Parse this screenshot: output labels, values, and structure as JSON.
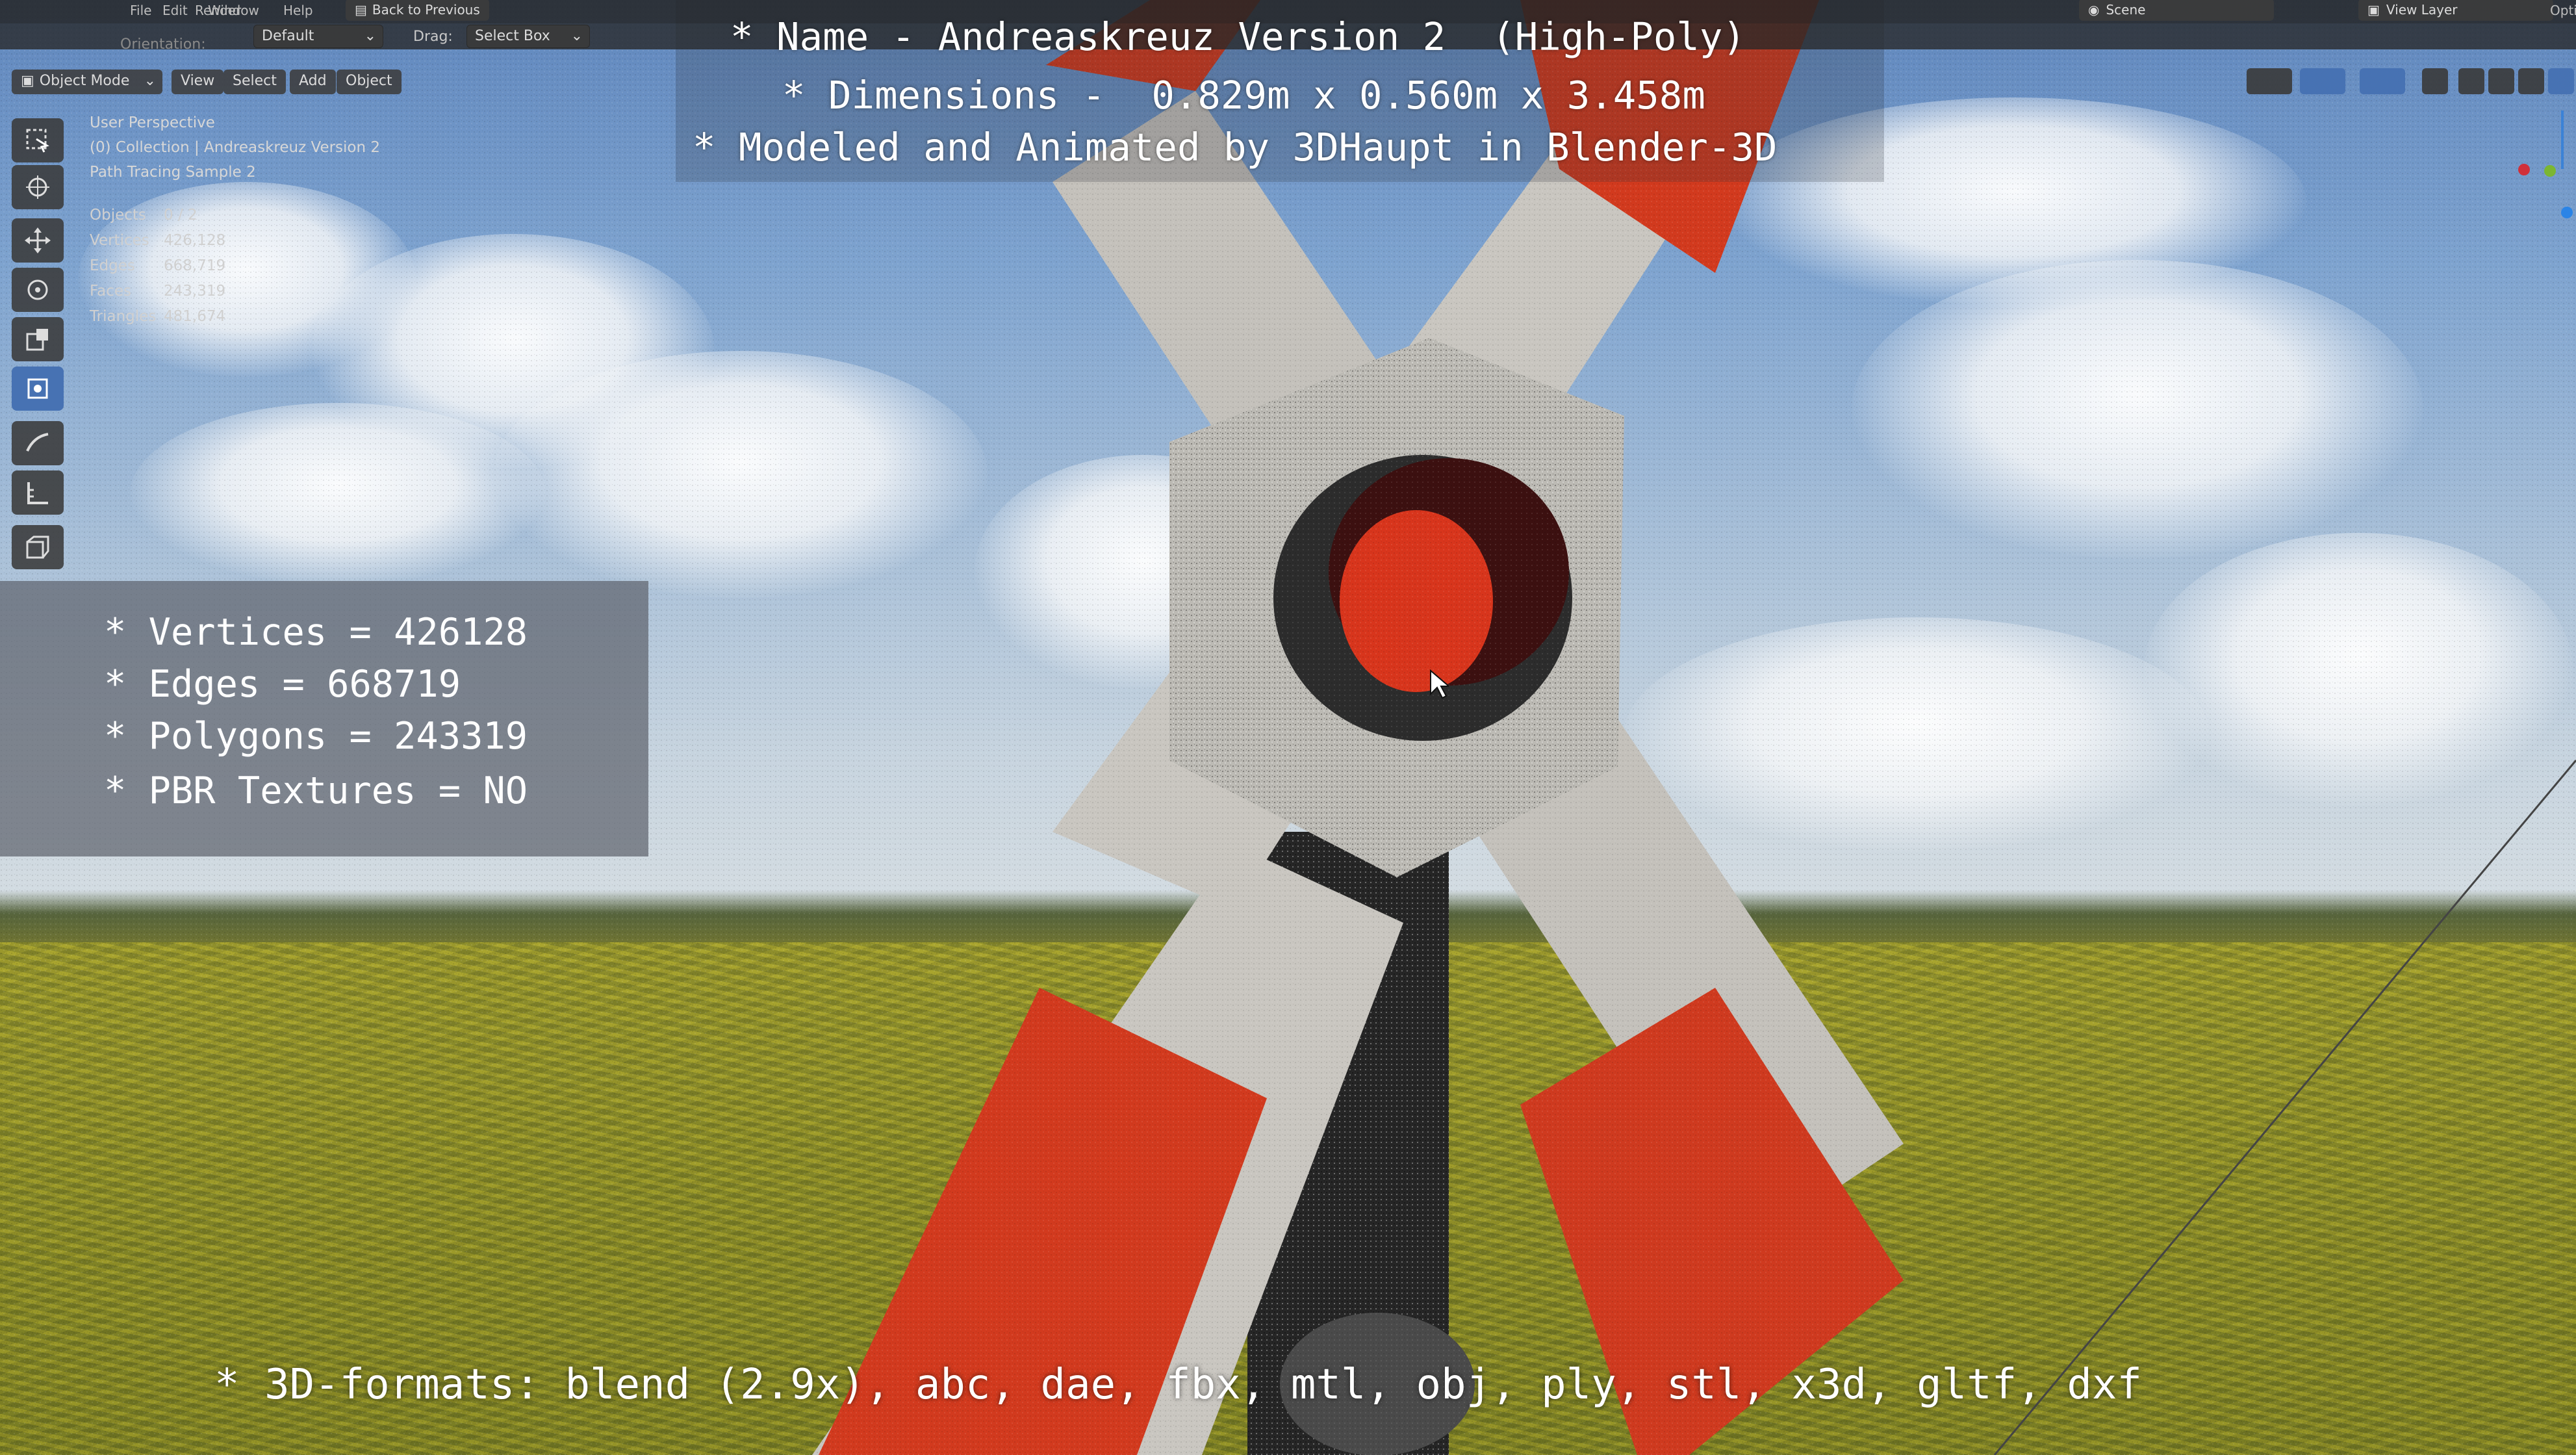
{
  "topbar": {
    "menu": [
      "File",
      "Edit",
      "Render",
      "Window",
      "Help"
    ],
    "back_button": "Back to Previous",
    "scene_label": "Scene",
    "view_layer_label": "View Layer",
    "options_label": "Opti"
  },
  "header": {
    "orientation_label": "Orientation:",
    "orientation_value": "Default",
    "drag_label": "Drag:",
    "drag_value": "Select Box"
  },
  "viewport_header": {
    "mode": "Object Mode",
    "menus": [
      "View",
      "Select",
      "Add",
      "Object"
    ]
  },
  "viewport_info": {
    "perspective": "User Perspective",
    "collection": "(0) Collection | Andreaskreuz Version 2",
    "render_status": "Path Tracing Sample 2"
  },
  "stats": {
    "rows": [
      {
        "label": "Objects",
        "value": "0 / 2"
      },
      {
        "label": "Vertices",
        "value": "426,128"
      },
      {
        "label": "Edges",
        "value": "668,719"
      },
      {
        "label": "Faces",
        "value": "243,319"
      },
      {
        "label": "Triangles",
        "value": "481,674"
      }
    ]
  },
  "title_overlay": {
    "line1": "* Name - Andreaskreuz Version 2  (High-Poly)",
    "line2": "* Dimensions -  0.829m x 0.560m x 3.458m",
    "line3": "* Modeled and Animated by 3DHaupt in Blender-3D"
  },
  "info_box": {
    "lines": [
      "* Vertices = 426128",
      "* Edges = 668719",
      "* Polygons = 243319",
      "* PBR Textures = NO"
    ]
  },
  "formats_line": "* 3D-formats: blend (2.9x), abc, dae, fbx, mtl, obj, ply, stl, x3d, gltf, dxf",
  "tools": [
    "select-box-tool",
    "cursor-tool",
    "move-tool",
    "rotate-tool",
    "scale-tool",
    "transform-tool",
    "annotate-tool",
    "measure-tool",
    "add-cube-tool"
  ],
  "colors": {
    "cross_red": "#d23a1e",
    "cross_white": "#c9c6c0",
    "tool_active": "#4772b3",
    "ui_dark": "#2b2b2b"
  }
}
